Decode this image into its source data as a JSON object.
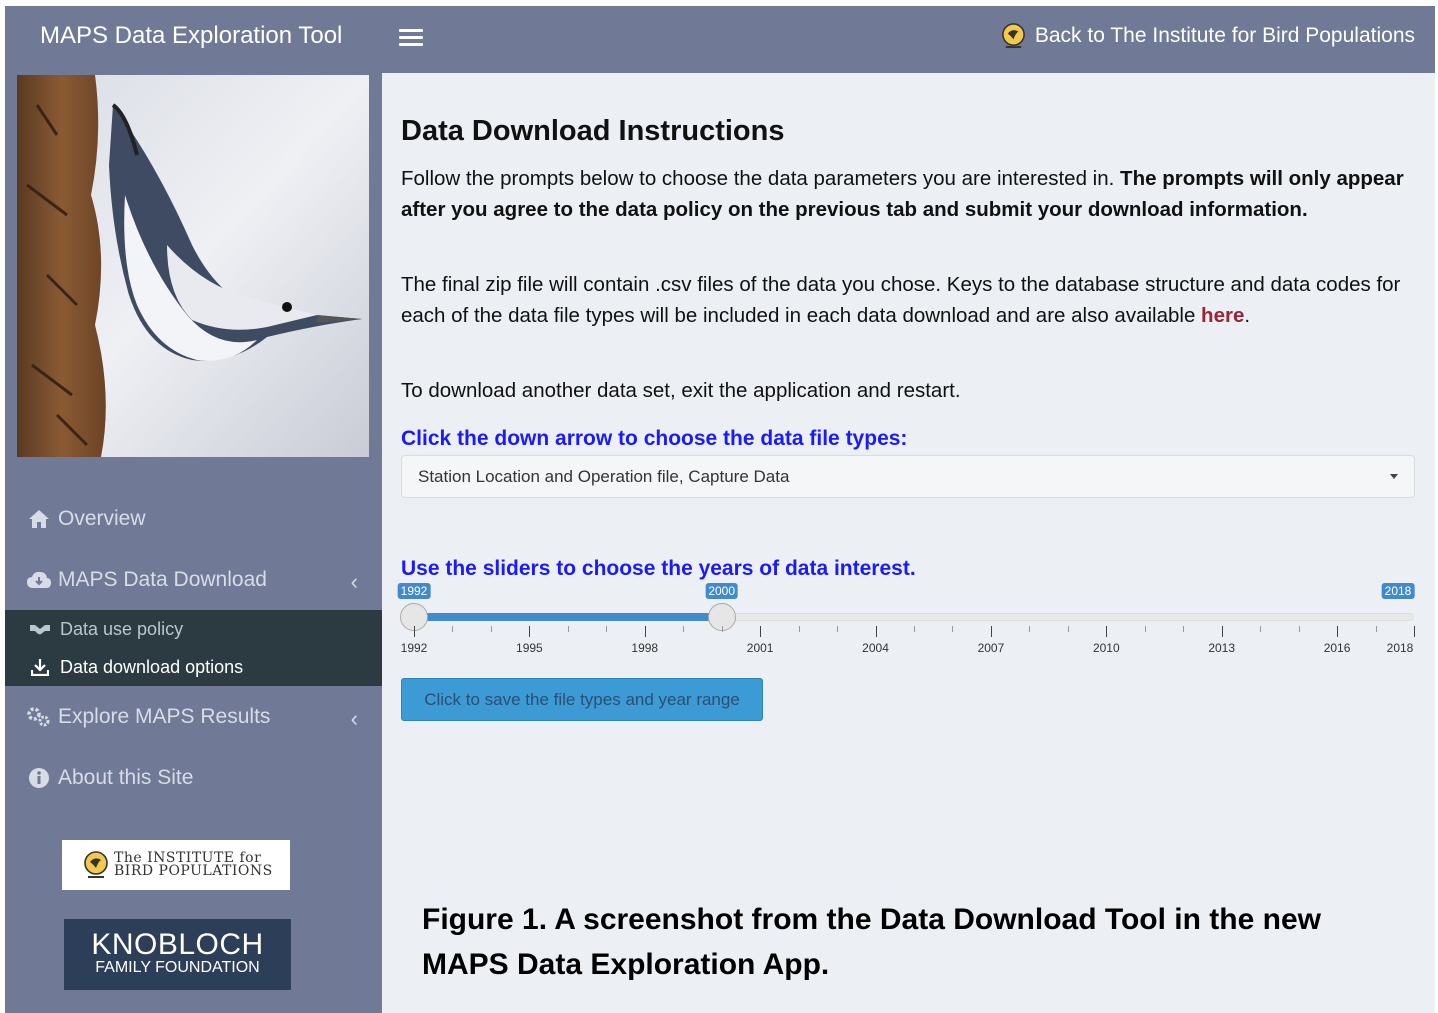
{
  "header": {
    "app_title": "MAPS Data Exploration Tool",
    "back_link": "Back to The Institute for Bird Populations"
  },
  "sidebar": {
    "menu": [
      {
        "label": "Overview",
        "icon": "home-icon"
      },
      {
        "label": "MAPS Data Download",
        "icon": "cloud-download-icon"
      },
      {
        "label": "Explore MAPS Results",
        "icon": "gears-icon"
      },
      {
        "label": "About this Site",
        "icon": "info-circle-icon"
      }
    ],
    "submenu": [
      {
        "label": "Data use policy",
        "icon": "handshake-icon"
      },
      {
        "label": "Data download options",
        "icon": "download-icon"
      }
    ],
    "ibp_logo": {
      "line1": "The INSTITUTE for",
      "line2": "BIRD POPULATIONS"
    },
    "knobloch_logo": {
      "line1": "KNOBLOCH",
      "line2": "FAMILY FOUNDATION"
    }
  },
  "main": {
    "title": "Data Download Instructions",
    "para1_normal": "Follow the prompts below to choose the data parameters you are interested in. ",
    "para1_bold": "The prompts will only appear after you agree to the data policy on the previous tab and submit your download information.",
    "para2_text": "The final zip file will contain .csv files of the data you chose. Keys to the database structure and data codes for each of the data file types will be included in each data download and are also available ",
    "para2_link": "here",
    "para2_end": ".",
    "para3": "To download another data set, exit the application and restart.",
    "file_types_label": "Click the down arrow to choose the data file types:",
    "file_types_value": "Station Location and Operation file, Capture Data",
    "years_label": "Use the sliders to choose the years of data interest.",
    "slider": {
      "min": 1992,
      "max": 2018,
      "from": 1992,
      "to": 2000,
      "min_label": "1992",
      "max_label": "2018",
      "from_label": "1992",
      "to_label": "2000",
      "tick_labels": [
        "1992",
        "1995",
        "1998",
        "2001",
        "2004",
        "2007",
        "2010",
        "2013",
        "2016",
        "2018"
      ]
    },
    "save_button": "Click to save the file types and year range"
  },
  "caption": "Figure 1. A screenshot from the Data Download Tool in the new MAPS Data Exploration App.",
  "colors": {
    "header_bg": "#707a96",
    "sidebar_bg": "#707a96",
    "submenu_bg": "#2c3b41",
    "content_bg": "#ecf0f5",
    "accent_blue": "#1a1aff",
    "link_red": "#9b2335",
    "slider_blue": "#428bca"
  }
}
